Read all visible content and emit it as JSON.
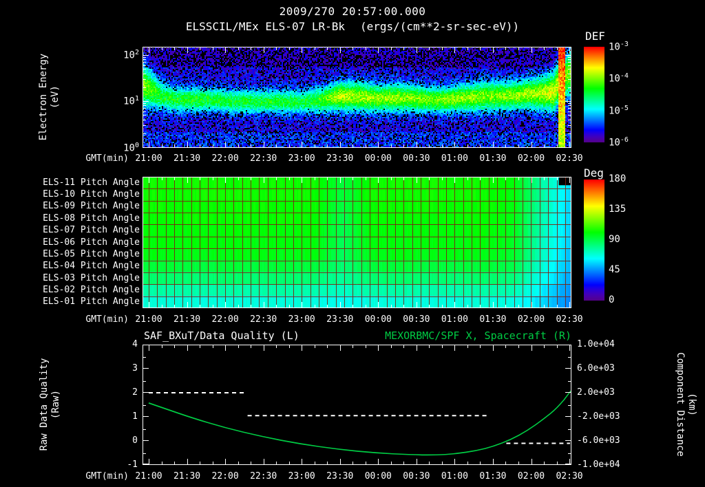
{
  "header": {
    "timestamp": "2009/270 20:57:00.000",
    "dataset": "ELSSCIL/MEx ELS-07 LR-Bk",
    "units": "(ergs/(cm**2-sr-sec-eV))",
    "def_colorbar_title": "DEF",
    "deg_colorbar_title": "Deg"
  },
  "power_base": "10",
  "axes": {
    "time_label": "GMT(min)",
    "time_ticks": [
      "21:00",
      "21:30",
      "22:00",
      "22:30",
      "23:00",
      "23:30",
      "00:00",
      "00:30",
      "01:00",
      "01:30",
      "02:00",
      "02:30"
    ],
    "energy_axis": {
      "name_line": "Electron Energy",
      "unit_line": "(eV)",
      "tick_exponents": [
        "2",
        "1",
        "0"
      ]
    },
    "def_colorbar": {
      "tick_exponents": [
        "-3",
        "-4",
        "-5",
        "-6"
      ]
    },
    "deg_colorbar": {
      "ticks": [
        "180",
        "135",
        "90",
        "45",
        "0"
      ]
    },
    "quality_axis": {
      "name_line": "Raw Data Quality",
      "unit_line": "(Raw)",
      "ticks": [
        "4",
        "3",
        "2",
        "1",
        "0",
        "-1"
      ]
    },
    "distance_axis": {
      "name_line": "Component Distance",
      "unit_line": "(km)",
      "ticks": [
        "1.0e+04",
        "6.0e+03",
        "2.0e+03",
        "-2.0e+03",
        "-6.0e+03",
        "-1.0e+04"
      ]
    }
  },
  "pitch_row_labels": [
    "ELS-11 Pitch Angle",
    "ELS-10 Pitch Angle",
    "ELS-09 Pitch Angle",
    "ELS-08 Pitch Angle",
    "ELS-07 Pitch Angle",
    "ELS-06 Pitch Angle",
    "ELS-05 Pitch Angle",
    "ELS-04 Pitch Angle",
    "ELS-03 Pitch Angle",
    "ELS-02 Pitch Angle",
    "ELS-01 Pitch Angle"
  ],
  "panel3_titles": {
    "left": "SAF_BXuT/Data Quality (L)",
    "right": "MEXORBMC/SPF X, Spacecraft (R)"
  },
  "colors": {
    "background": "#000000",
    "text": "#ffffff",
    "accent_green": "#00cc44",
    "grid_red": "#7d1f10"
  },
  "chart_data": [
    {
      "type": "heatmap",
      "name": "electron-energy-spectrogram",
      "title": "ELSSCIL/MEx ELS-07 LR-Bk",
      "units": "ergs/(cm**2-sr-sec-eV)",
      "xlabel": "GMT(min)",
      "ylabel": "Electron Energy (eV)",
      "x_ticks": [
        "21:00",
        "21:30",
        "22:00",
        "22:30",
        "23:00",
        "23:30",
        "00:00",
        "00:30",
        "01:00",
        "01:30",
        "02:00",
        "02:30"
      ],
      "y_scale": "log",
      "y_range_eV": [
        1,
        150
      ],
      "color_log10_range": [
        -6,
        -3
      ],
      "background_log10": -5.68,
      "band": {
        "description": "low-energy electron flux band vs time, 25 bins from 21:00 to 02:35",
        "center_eV": [
          22,
          13,
          11,
          11,
          11,
          10,
          10,
          10,
          10,
          10,
          11,
          13,
          13,
          12,
          12,
          12,
          11,
          11,
          12,
          13,
          13,
          14,
          15,
          16,
          45
        ],
        "peak_log10": [
          -4.0,
          -4.3,
          -4.35,
          -4.3,
          -4.4,
          -4.35,
          -4.4,
          -4.35,
          -4.4,
          -4.4,
          -4.2,
          -3.85,
          -3.9,
          -3.95,
          -3.95,
          -4.0,
          -4.05,
          -4.0,
          -3.95,
          -4.0,
          -4.0,
          -3.95,
          -3.9,
          -3.7,
          -4.1
        ],
        "width_decades": [
          0.45,
          0.28,
          0.25,
          0.25,
          0.25,
          0.24,
          0.24,
          0.24,
          0.24,
          0.24,
          0.26,
          0.3,
          0.3,
          0.28,
          0.28,
          0.28,
          0.26,
          0.26,
          0.28,
          0.3,
          0.3,
          0.3,
          0.32,
          0.4,
          0.5
        ]
      },
      "burst": {
        "time_frac": 0.978,
        "half_width": 0.007,
        "base_log10": -3.9,
        "energy_slope": 0.38
      }
    },
    {
      "type": "heatmap",
      "name": "pitch-angle-panel",
      "rows": [
        "ELS-11",
        "ELS-10",
        "ELS-09",
        "ELS-08",
        "ELS-07",
        "ELS-06",
        "ELS-05",
        "ELS-04",
        "ELS-03",
        "ELS-02",
        "ELS-01"
      ],
      "x_ticks": [
        "21:00",
        "21:30",
        "22:00",
        "22:30",
        "23:00",
        "23:30",
        "00:00",
        "00:30",
        "01:00",
        "01:30",
        "02:00",
        "02:30"
      ],
      "value_range_deg": [
        0,
        180
      ],
      "values_deg": [
        [
          104,
          104,
          104,
          103,
          104,
          103,
          104,
          92,
          103,
          104,
          104,
          103,
          104,
          100,
          76,
          56
        ],
        [
          104,
          103,
          104,
          104,
          103,
          104,
          103,
          92,
          104,
          103,
          104,
          104,
          103,
          100,
          76,
          56
        ],
        [
          103,
          103,
          102,
          103,
          103,
          102,
          103,
          91,
          102,
          103,
          103,
          102,
          103,
          99,
          75,
          55
        ],
        [
          102,
          102,
          103,
          102,
          102,
          103,
          102,
          90,
          102,
          102,
          101,
          102,
          102,
          98,
          74,
          55
        ],
        [
          101,
          101,
          100,
          101,
          101,
          100,
          101,
          89,
          101,
          100,
          101,
          100,
          101,
          97,
          73,
          54
        ],
        [
          100,
          100,
          101,
          100,
          99,
          100,
          100,
          88,
          100,
          99,
          100,
          99,
          100,
          96,
          72,
          53
        ],
        [
          99,
          99,
          98,
          99,
          99,
          98,
          99,
          88,
          98,
          99,
          98,
          99,
          98,
          95,
          71,
          52
        ],
        [
          93,
          93,
          92,
          93,
          92,
          93,
          92,
          84,
          92,
          93,
          92,
          92,
          93,
          90,
          68,
          50
        ],
        [
          85,
          85,
          84,
          85,
          84,
          85,
          84,
          78,
          84,
          85,
          84,
          84,
          85,
          82,
          64,
          48
        ],
        [
          76,
          76,
          75,
          76,
          75,
          76,
          75,
          71,
          75,
          76,
          75,
          75,
          76,
          74,
          60,
          45
        ],
        [
          68,
          68,
          67,
          68,
          67,
          68,
          67,
          64,
          67,
          68,
          67,
          67,
          68,
          66,
          56,
          43
        ]
      ],
      "missing": [
        {
          "row": 0,
          "x_frac": [
            0.972,
            1.0
          ]
        }
      ]
    },
    {
      "type": "line",
      "name": "quality-and-spacecraft-distance",
      "x_ticks": [
        "21:00",
        "21:30",
        "22:00",
        "22:30",
        "23:00",
        "23:30",
        "00:00",
        "00:30",
        "01:00",
        "01:30",
        "02:00",
        "02:30"
      ],
      "left_axis": {
        "label": "Raw Data Quality (Raw)",
        "range": [
          -1,
          4
        ]
      },
      "right_axis": {
        "label": "Component Distance (km)",
        "range": [
          -10000,
          10000
        ]
      },
      "series": [
        {
          "name": "SAF_BXuT/Data Quality (L)",
          "axis": "left",
          "style": "dashed",
          "color": "#ffffff",
          "segments": [
            {
              "x_frac": [
                0.0,
                0.228
              ],
              "value": 2.0
            },
            {
              "x_frac": [
                0.235,
                0.81
              ],
              "value": 1.05
            },
            {
              "x_frac": [
                0.85,
                1.005
              ],
              "value": -0.1
            }
          ]
        },
        {
          "name": "MEXORBMC/SPF X, Spacecraft (R)",
          "axis": "right",
          "style": "solid",
          "color": "#00cc44",
          "points": [
            [
              0.0,
              300
            ],
            [
              0.05,
              -900
            ],
            [
              0.1,
              -2100
            ],
            [
              0.18,
              -3800
            ],
            [
              0.27,
              -5300
            ],
            [
              0.36,
              -6500
            ],
            [
              0.45,
              -7400
            ],
            [
              0.54,
              -8000
            ],
            [
              0.62,
              -8300
            ],
            [
              0.68,
              -8350
            ],
            [
              0.73,
              -8150
            ],
            [
              0.78,
              -7600
            ],
            [
              0.82,
              -6900
            ],
            [
              0.86,
              -5800
            ],
            [
              0.9,
              -4300
            ],
            [
              0.94,
              -2300
            ],
            [
              0.97,
              -600
            ],
            [
              1.005,
              2300
            ]
          ]
        }
      ]
    }
  ]
}
